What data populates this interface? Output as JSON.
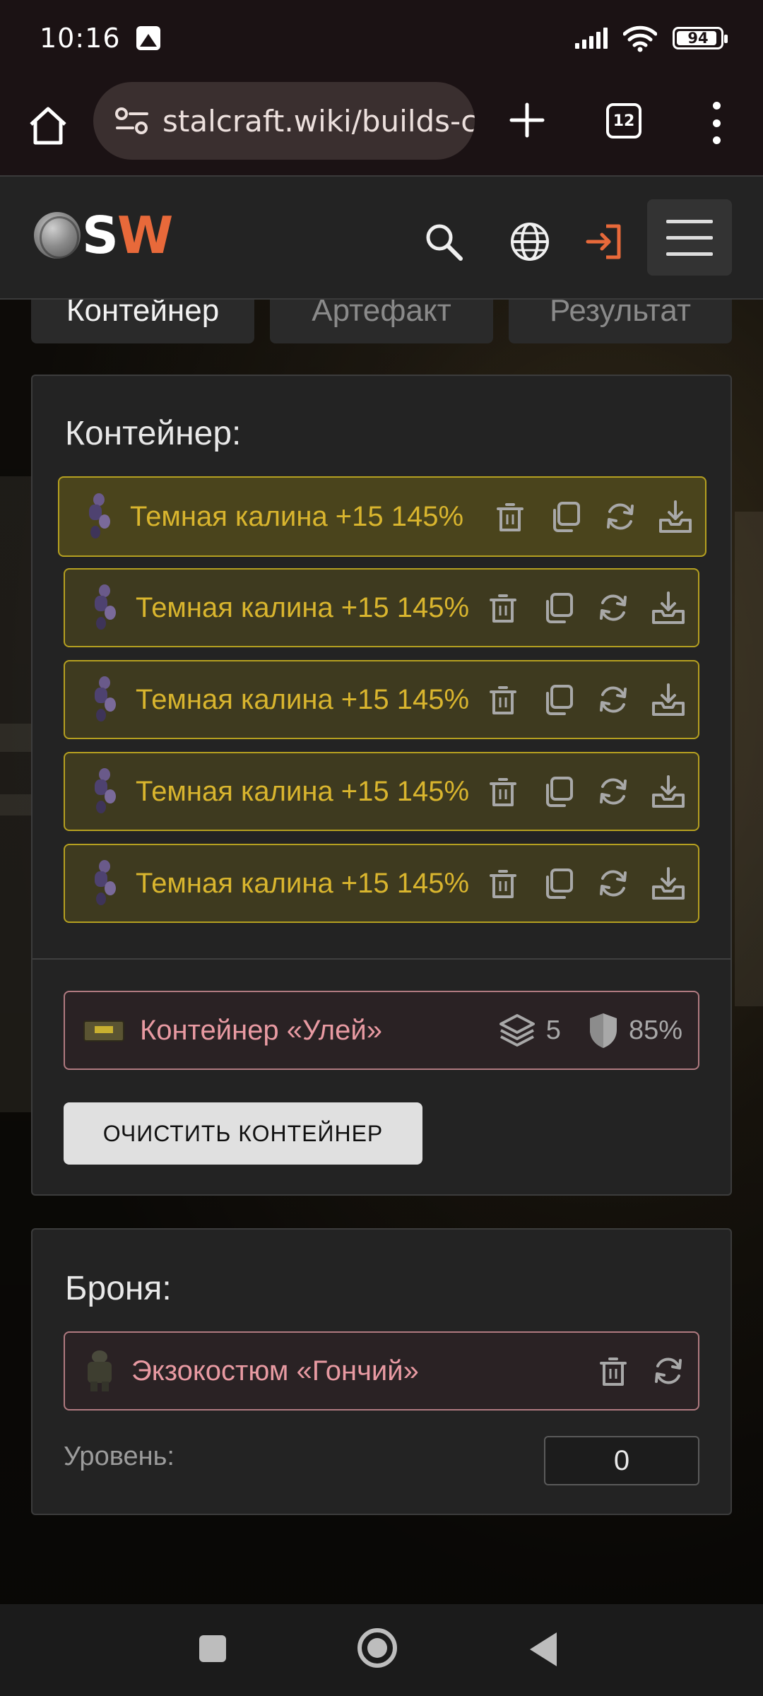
{
  "status_bar": {
    "time": "10:16",
    "battery": "94",
    "battery_level": 0.94
  },
  "browser": {
    "url": "stalcraft.wiki/builds-ca",
    "tab_count": "12"
  },
  "site": {
    "logo_s": "S",
    "logo_w": "W",
    "brand_color": "#e8693a"
  },
  "tabs": [
    {
      "label": "Контейнер",
      "active": true
    },
    {
      "label": "Артефакт",
      "active": false
    },
    {
      "label": "Результат",
      "active": false
    }
  ],
  "container_panel": {
    "title": "Контейнер:",
    "artifacts": [
      {
        "name": "Темная калина +15 145%"
      },
      {
        "name": "Темная калина +15 145%"
      },
      {
        "name": "Темная калина +15 145%"
      },
      {
        "name": "Темная калина +15 145%"
      },
      {
        "name": "Темная калина +15 145%"
      }
    ],
    "container": {
      "name": "Контейнер «Улей»",
      "slots": "5",
      "protection": "85%"
    },
    "clear_button": "ОЧИСТИТЬ КОНТЕЙНЕР"
  },
  "armor_panel": {
    "title": "Броня:",
    "armor": {
      "name": "Экзокостюм «Гончий»"
    },
    "level_label": "Уровень:",
    "level_value": "0"
  },
  "colors": {
    "artifact_accent": "#d9b52e",
    "container_accent": "#e89aa2"
  }
}
